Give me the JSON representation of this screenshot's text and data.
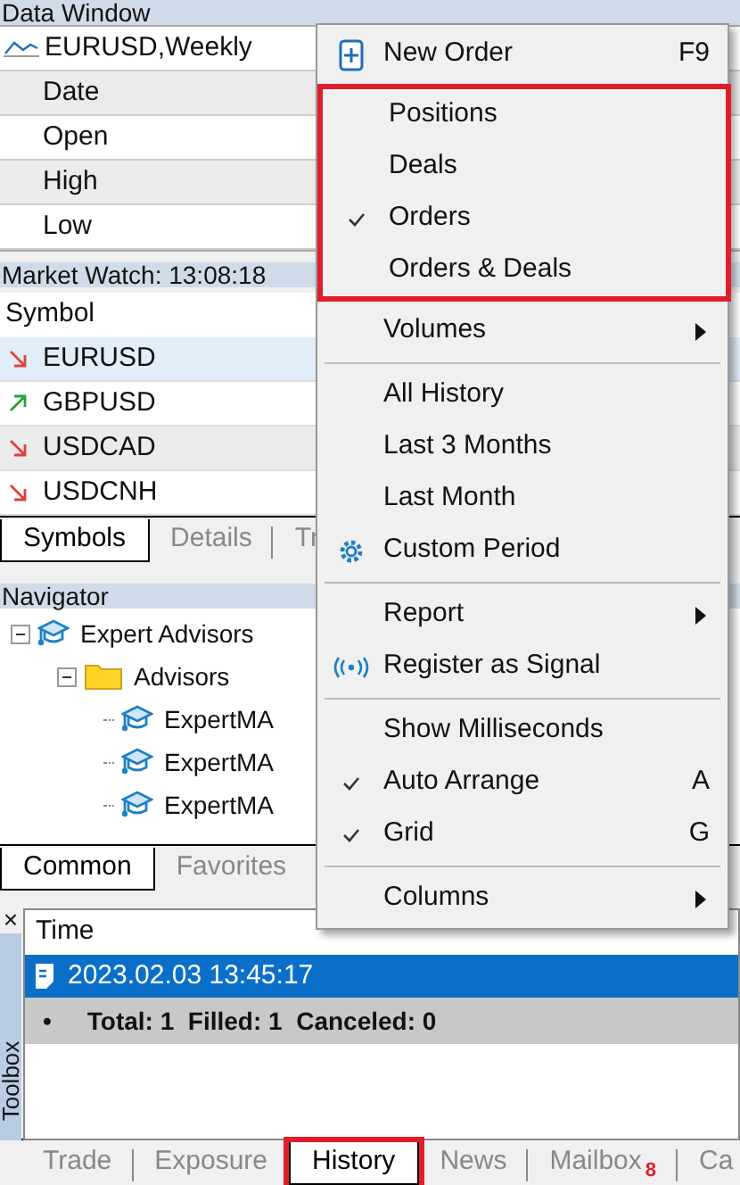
{
  "data_window": {
    "title": "Data Window",
    "symbol": "EURUSD,Weekly",
    "rows": [
      "Date",
      "Open",
      "High",
      "Low"
    ]
  },
  "market_watch": {
    "title": "Market Watch: 13:08:18",
    "column": "Symbol",
    "rows": [
      {
        "symbol": "EURUSD",
        "kind": "down",
        "selected": true
      },
      {
        "symbol": "GBPUSD",
        "kind": "up",
        "selected": false
      },
      {
        "symbol": "USDCAD",
        "kind": "down",
        "selected": false
      },
      {
        "symbol": "USDCNH",
        "kind": "down",
        "selected": false
      }
    ],
    "tabs": [
      {
        "label": "Symbols",
        "selected": true
      },
      {
        "label": "Details",
        "selected": false
      },
      {
        "label": "Tr",
        "selected": false
      }
    ]
  },
  "navigator": {
    "title": "Navigator",
    "tree": [
      {
        "label": "Expert Advisors",
        "kind": "cap",
        "expanded": true,
        "children": [
          {
            "label": "Advisors",
            "kind": "folder",
            "expanded": true,
            "children": [
              {
                "label": "ExpertMA",
                "kind": "cap"
              },
              {
                "label": "ExpertMA",
                "kind": "cap"
              },
              {
                "label": "ExpertMA",
                "kind": "cap"
              }
            ]
          }
        ]
      }
    ],
    "tabs": [
      {
        "label": "Common",
        "selected": true
      },
      {
        "label": "Favorites",
        "selected": false
      }
    ]
  },
  "toolbox": {
    "side_label": "Toolbox",
    "close": "×",
    "column": "Time",
    "row": {
      "time": "2023.02.03 13:45:17",
      "selected": true
    },
    "summary": {
      "bullet": "•",
      "text": "Total: 1  Filled: 1  Canceled: 0"
    },
    "tabs": [
      {
        "label": "Trade",
        "selected": false,
        "highlighted": false
      },
      {
        "label": "Exposure",
        "selected": false,
        "highlighted": false
      },
      {
        "label": "History",
        "selected": true,
        "highlighted": true
      },
      {
        "label": "News",
        "selected": false,
        "highlighted": false
      },
      {
        "label": "Mailbox",
        "badge": "8",
        "selected": false,
        "highlighted": false
      },
      {
        "label": "Ca",
        "selected": false,
        "highlighted": false
      }
    ]
  },
  "context_menu": {
    "sections": [
      {
        "items": [
          {
            "label": "New Order",
            "shortcut": "F9",
            "kind": "new-order",
            "checked": false,
            "submenu": false
          }
        ]
      },
      {
        "highlighted": true,
        "items": [
          {
            "label": "Positions",
            "checked": false,
            "submenu": false
          },
          {
            "label": "Deals",
            "checked": false,
            "submenu": false
          },
          {
            "label": "Orders",
            "checked": true,
            "submenu": false
          },
          {
            "label": "Orders & Deals",
            "checked": false,
            "submenu": false
          }
        ]
      },
      {
        "items": [
          {
            "label": "Volumes",
            "checked": false,
            "submenu": true
          }
        ]
      },
      {
        "items": [
          {
            "label": "All History",
            "checked": false,
            "submenu": false
          },
          {
            "label": "Last 3 Months",
            "checked": false,
            "submenu": false
          },
          {
            "label": "Last Month",
            "checked": false,
            "submenu": false
          },
          {
            "label": "Custom Period",
            "kind": "gear",
            "checked": false,
            "submenu": false
          }
        ]
      },
      {
        "items": [
          {
            "label": "Report",
            "checked": false,
            "submenu": true
          },
          {
            "label": "Register as Signal",
            "kind": "signal",
            "checked": false,
            "submenu": false
          }
        ]
      },
      {
        "items": [
          {
            "label": "Show Milliseconds",
            "checked": false,
            "submenu": false
          },
          {
            "label": "Auto Arrange",
            "shortcut": "A",
            "checked": true,
            "submenu": false
          },
          {
            "label": "Grid",
            "shortcut": "G",
            "checked": true,
            "submenu": false
          }
        ]
      },
      {
        "items": [
          {
            "label": "Columns",
            "checked": false,
            "submenu": true
          }
        ]
      }
    ]
  }
}
